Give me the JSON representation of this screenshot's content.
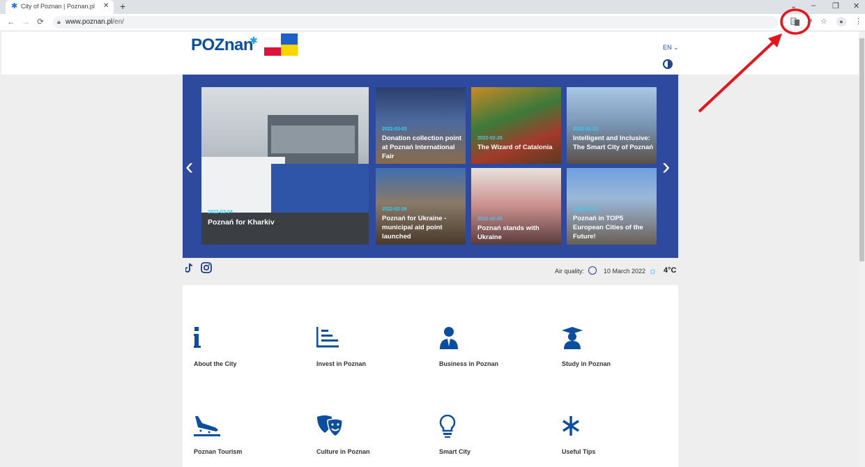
{
  "browser": {
    "tab_title": "City of Poznan | Poznan.pl",
    "url_host": "www.poznan.pl",
    "url_path": "/en/"
  },
  "header": {
    "logo_text": "POZnan",
    "language": "EN ⌄"
  },
  "slider": {
    "main": {
      "date": "2022-03-04",
      "title": "Poznań for Kharkiv"
    },
    "tiles": [
      {
        "date": "2022-03-03",
        "title": "Donation collection point at Poznań International Fair"
      },
      {
        "date": "2022-02-28",
        "title": "The Wizard of Catalonia"
      },
      {
        "date": "2022-02-23",
        "title": "Intelligent and Inclusive: The Smart City of Poznań"
      },
      {
        "date": "2022-02-26",
        "title": "Poznań for Ukraine - municipal aid point launched"
      },
      {
        "date": "2022-02-25",
        "title": "Poznań stands with Ukraine"
      },
      {
        "date": "2022-02-22",
        "title": "Poznań in TOP5 European Cities of the Future!"
      }
    ]
  },
  "status": {
    "air_quality_label": "Air quality:",
    "date": "10 March 2022",
    "temperature": "4°C"
  },
  "categories": [
    {
      "label": "About the City",
      "icon": "info-icon"
    },
    {
      "label": "Invest in Poznan",
      "icon": "chart-icon"
    },
    {
      "label": "Business in Poznan",
      "icon": "businessman-icon"
    },
    {
      "label": "Study in Poznan",
      "icon": "graduate-icon"
    },
    {
      "label": "Poznan Tourism",
      "icon": "plane-landing-icon"
    },
    {
      "label": "Culture in Poznan",
      "icon": "theatre-masks-icon"
    },
    {
      "label": "Smart City",
      "icon": "lightbulb-icon"
    },
    {
      "label": "Useful Tips",
      "icon": "asterisk-icon"
    }
  ],
  "colors": {
    "brand_blue": "#0a4ea0",
    "slider_bg": "#2d4a9e",
    "date_accent": "#41c9f2",
    "annotation_red": "#e8141c"
  }
}
